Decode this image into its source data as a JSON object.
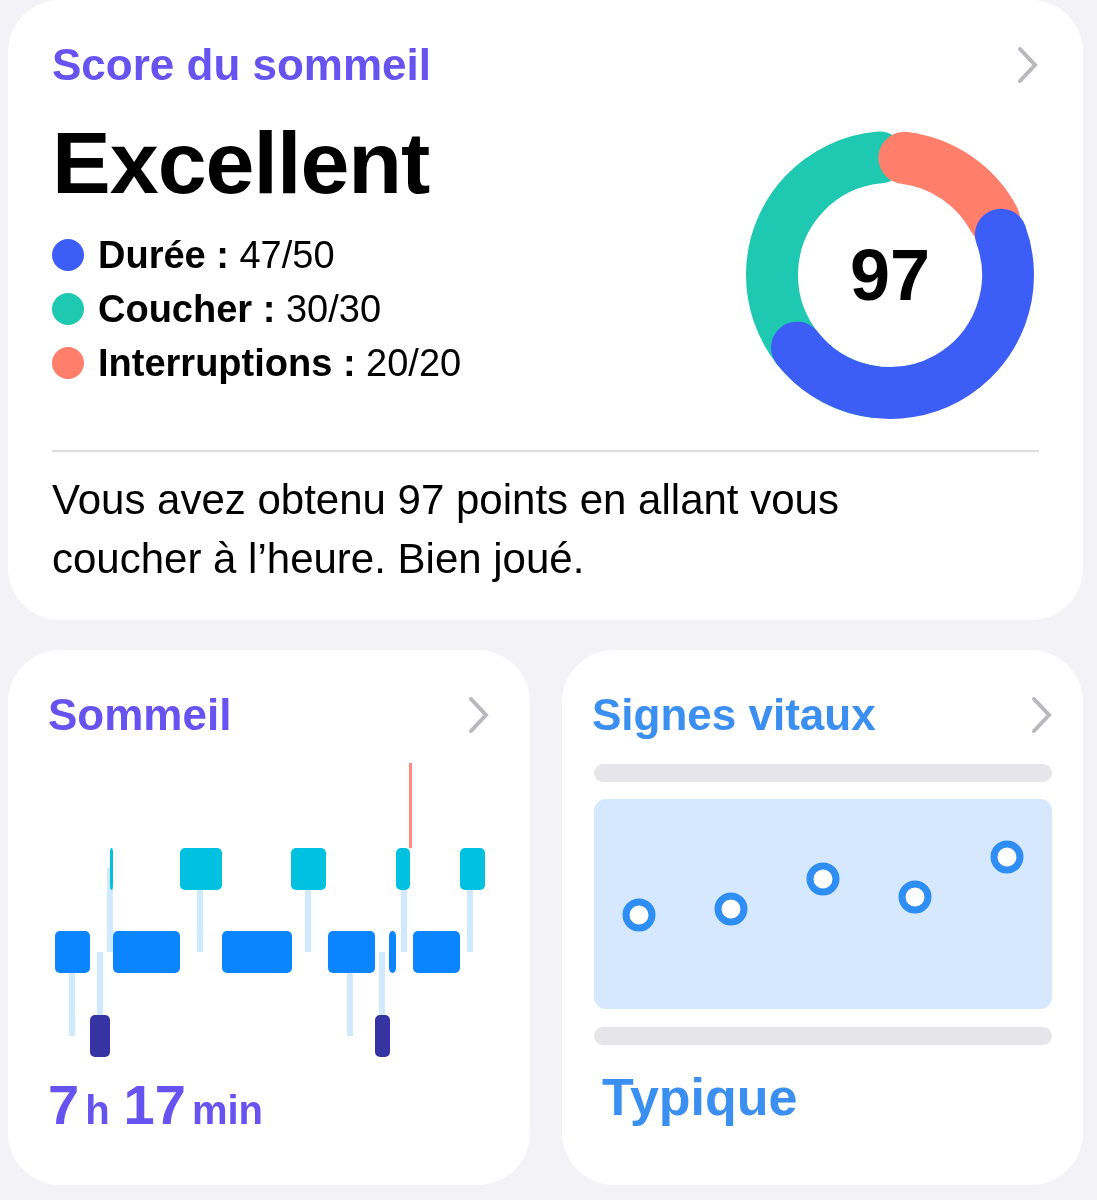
{
  "score_card": {
    "title": "Score du sommeil",
    "rating": "Excellent",
    "score": "97",
    "legend": [
      {
        "text": "**Durée :** 47/50",
        "color": "#3d5ef6"
      },
      {
        "text": "**Coucher :** 30/30",
        "color": "#1fc8b0"
      },
      {
        "text": "**Interruptions :** 20/20",
        "color": "#ff7f6a"
      }
    ],
    "message": "Vous avez obtenu 97 points en allant vous coucher à l’heure. Bien joué."
  },
  "sleep_card": {
    "title": "Sommeil",
    "duration": [
      {
        "text": "7",
        "kind": "number"
      },
      {
        "text": "h",
        "kind": "unit"
      },
      {
        "text": "17",
        "kind": "number"
      },
      {
        "text": "min",
        "kind": "unit"
      }
    ]
  },
  "vitals_card": {
    "title": "Signes vitaux",
    "status": "Typique"
  }
}
